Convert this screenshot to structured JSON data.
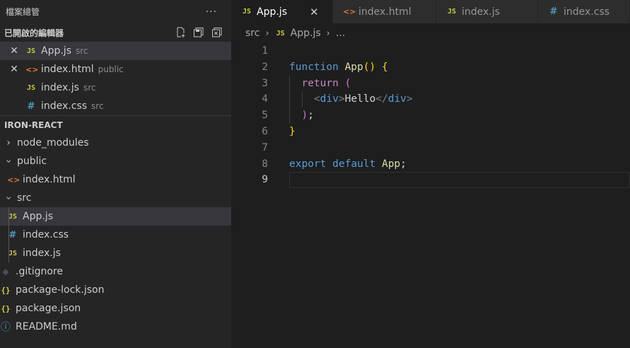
{
  "explorer": {
    "title": "檔案總管",
    "more": "···",
    "open_editors": {
      "title": "已開啟的編輯器",
      "items": [
        {
          "name": "App.js",
          "desc": "src",
          "icon": "JS",
          "close": "✕"
        },
        {
          "name": "index.html",
          "desc": "public",
          "icon": "<>",
          "close": "✕"
        },
        {
          "name": "index.js",
          "desc": "src",
          "icon": "JS"
        },
        {
          "name": "index.css",
          "desc": "src",
          "icon": "#"
        }
      ]
    },
    "project": {
      "title": "IRON-REACT",
      "tree": [
        {
          "name": "node_modules"
        },
        {
          "name": "public"
        },
        {
          "name": "index.html"
        },
        {
          "name": "src"
        },
        {
          "name": "App.js"
        },
        {
          "name": "index.css"
        },
        {
          "name": "index.js"
        },
        {
          "name": ".gitignore"
        },
        {
          "name": "package-lock.json"
        },
        {
          "name": "package.json"
        },
        {
          "name": "README.md"
        }
      ]
    }
  },
  "tabs": [
    {
      "label": "App.js",
      "icon": "JS",
      "close": "✕"
    },
    {
      "label": "index.html",
      "icon": "<>"
    },
    {
      "label": "index.js",
      "icon": "JS"
    },
    {
      "label": "index.css",
      "icon": "#"
    }
  ],
  "breadcrumb": {
    "folder": "src",
    "file": "App.js",
    "ellipsis": "..."
  },
  "editor": {
    "line_numbers": [
      "1",
      "2",
      "3",
      "4",
      "5",
      "6",
      "7",
      "8",
      "9"
    ],
    "tokens": {
      "function": "function",
      "App": "App",
      "parens": "()",
      "lbrace": "{",
      "return": "return",
      "lparen": "(",
      "lt": "<",
      "div": "div",
      "gt": ">",
      "hello": "Hello",
      "ltslash": "</",
      "rparen": ")",
      "semi": ";",
      "rbrace": "}",
      "export": "export",
      "default": "default",
      "App2": "App"
    }
  },
  "colors": {
    "accent_js": "#cbcb41",
    "accent_html": "#e37933",
    "accent_css": "#519aba"
  }
}
